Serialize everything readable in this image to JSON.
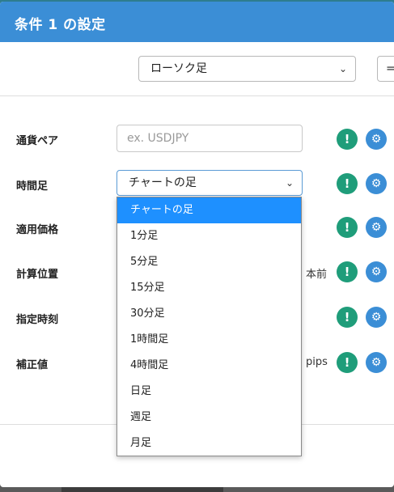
{
  "modal": {
    "title": "条件 1 の設定"
  },
  "top": {
    "chart_select_value": "ローソク足",
    "second_select_value": "="
  },
  "rows": [
    {
      "label": "通貨ペア",
      "suffix": ""
    },
    {
      "label": "時間足",
      "suffix": ""
    },
    {
      "label": "適用価格",
      "suffix": ""
    },
    {
      "label": "計算位置",
      "suffix": "本前"
    },
    {
      "label": "指定時刻",
      "suffix": ""
    },
    {
      "label": "補正値",
      "suffix": "pips"
    }
  ],
  "currency_input": {
    "placeholder": "ex. USDJPY"
  },
  "timeframe_select": {
    "value": "チャートの足"
  },
  "dropdown": {
    "options": [
      "チャートの足",
      "1分足",
      "5分足",
      "15分足",
      "30分足",
      "1時間足",
      "4時間足",
      "日足",
      "週足",
      "月足"
    ],
    "selected_index": 0
  },
  "icons": {
    "info": "exclamation-icon",
    "settings": "gear-icon"
  },
  "colors": {
    "header": "#3b8ed6",
    "info": "#1f9d7a",
    "settings": "#3b8ed6",
    "highlight": "#1e90ff"
  }
}
